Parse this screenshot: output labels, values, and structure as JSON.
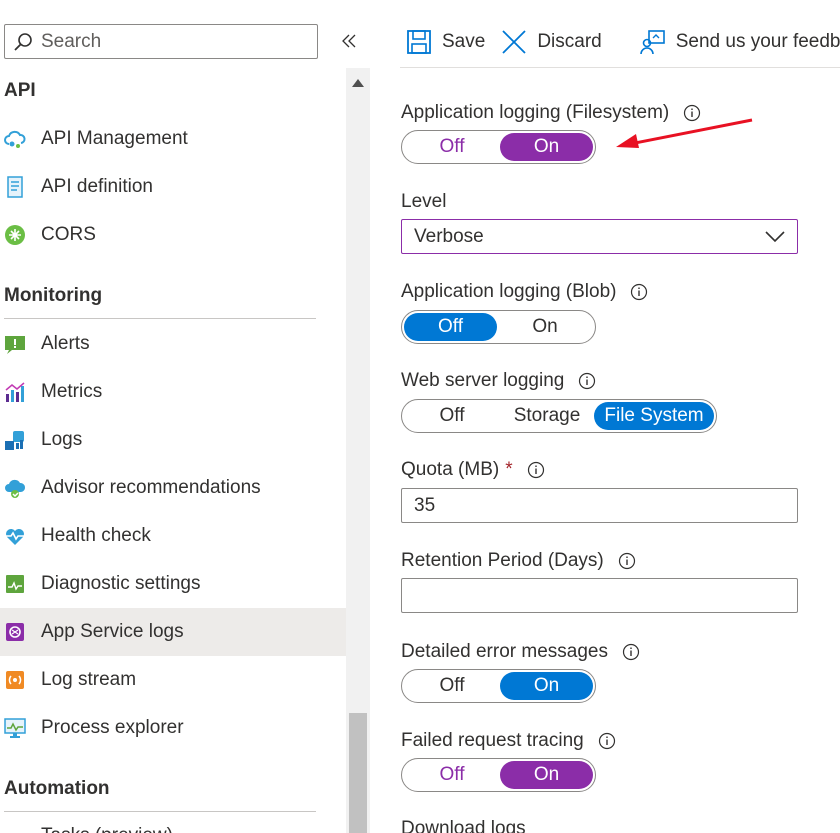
{
  "sidebar": {
    "search": {
      "placeholder": "Search",
      "value": ""
    },
    "sections": [
      {
        "title": "API",
        "items": [
          {
            "label": "API Management",
            "icon": "cloud-api-icon"
          },
          {
            "label": "API definition",
            "icon": "document-icon"
          },
          {
            "label": "CORS",
            "icon": "cors-icon"
          }
        ]
      },
      {
        "title": "Monitoring",
        "items": [
          {
            "label": "Alerts",
            "icon": "alert-icon"
          },
          {
            "label": "Metrics",
            "icon": "metrics-icon"
          },
          {
            "label": "Logs",
            "icon": "logs-icon"
          },
          {
            "label": "Advisor recommendations",
            "icon": "advisor-icon"
          },
          {
            "label": "Health check",
            "icon": "heart-icon"
          },
          {
            "label": "Diagnostic settings",
            "icon": "diagnostic-icon"
          },
          {
            "label": "App Service logs",
            "icon": "app-service-logs-icon",
            "active": true
          },
          {
            "label": "Log stream",
            "icon": "log-stream-icon"
          },
          {
            "label": "Process explorer",
            "icon": "process-explorer-icon"
          }
        ]
      },
      {
        "title": "Automation",
        "items": [
          {
            "label": "Tasks (preview)",
            "icon": "tasks-icon"
          }
        ]
      }
    ]
  },
  "toolbar": {
    "save_label": "Save",
    "discard_label": "Discard",
    "feedback_label": "Send us your feedback"
  },
  "form": {
    "app_logging_fs": {
      "label": "Application logging (Filesystem)",
      "options": [
        "Off",
        "On"
      ],
      "selected": "On"
    },
    "level": {
      "label": "Level",
      "value": "Verbose"
    },
    "app_logging_blob": {
      "label": "Application logging (Blob)",
      "options": [
        "Off",
        "On"
      ],
      "selected": "Off"
    },
    "web_server_logging": {
      "label": "Web server logging",
      "options": [
        "Off",
        "Storage",
        "File System"
      ],
      "selected": "File System"
    },
    "quota": {
      "label": "Quota (MB)",
      "required_mark": "*",
      "value": "35"
    },
    "retention": {
      "label": "Retention Period (Days)",
      "value": ""
    },
    "detailed_errors": {
      "label": "Detailed error messages",
      "options": [
        "Off",
        "On"
      ],
      "selected": "On"
    },
    "failed_request": {
      "label": "Failed request tracing",
      "options": [
        "Off",
        "On"
      ],
      "selected": "On"
    },
    "download_logs": {
      "label": "Download logs"
    }
  },
  "colors": {
    "accent_blue": "#0078d4",
    "accent_purple": "#8b2da8",
    "annotation_red": "#e81123",
    "active_row": "#edebe9"
  }
}
